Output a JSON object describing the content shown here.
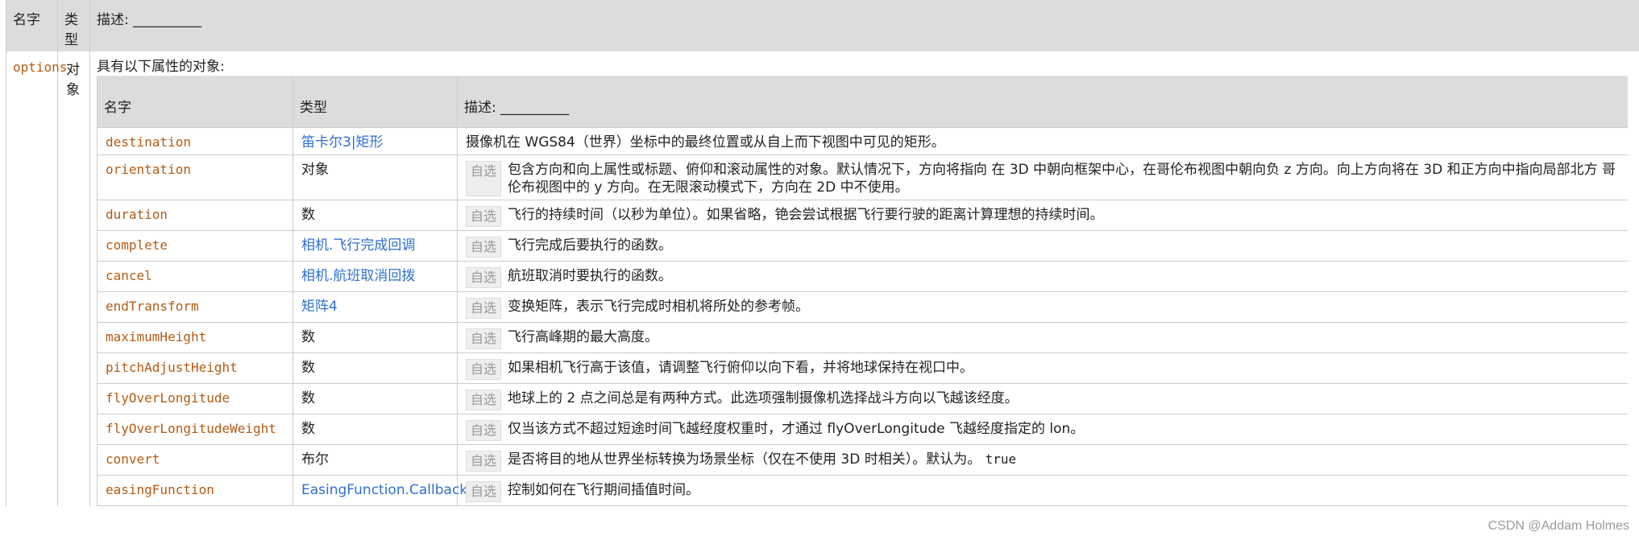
{
  "header": {
    "name": "名字",
    "type": "类型",
    "desc": "描述: __________"
  },
  "param": {
    "name": "options",
    "type": "对象",
    "intro": "具有以下属性的对象:"
  },
  "sub_header": {
    "name": "名字",
    "type": "类型",
    "desc": "描述: __________"
  },
  "optional_label": "自选",
  "rows": [
    {
      "name": "destination",
      "type": "笛卡尔3|矩形",
      "type_link": true,
      "optional": false,
      "desc": "摄像机在 WGS84（世界）坐标中的最终位置或从自上而下视图中可见的矩形。"
    },
    {
      "name": "orientation",
      "type": "对象",
      "type_link": false,
      "optional": true,
      "desc": "包含方向和向上属性或标题、俯仰和滚动属性的对象。默认情况下，方向将指向 在 3D 中朝向框架中心，在哥伦布视图中朝向负 z 方向。向上方向将在 3D 和正方向中指向局部北方 哥伦布视图中的 y 方向。在无限滚动模式下，方向在 2D 中不使用。"
    },
    {
      "name": "duration",
      "type": "数",
      "type_link": false,
      "optional": true,
      "desc": "飞行的持续时间（以秒为单位）。如果省略，铯会尝试根据飞行要行驶的距离计算理想的持续时间。"
    },
    {
      "name": "complete",
      "type": "相机.飞行完成回调",
      "type_link": true,
      "optional": true,
      "desc": "飞行完成后要执行的函数。"
    },
    {
      "name": "cancel",
      "type": "相机.航班取消回拨",
      "type_link": true,
      "optional": true,
      "desc": "航班取消时要执行的函数。"
    },
    {
      "name": "endTransform",
      "type": "矩阵4",
      "type_link": true,
      "optional": true,
      "desc": "变换矩阵，表示飞行完成时相机将所处的参考帧。"
    },
    {
      "name": "maximumHeight",
      "type": "数",
      "type_link": false,
      "optional": true,
      "desc": "飞行高峰期的最大高度。"
    },
    {
      "name": "pitchAdjustHeight",
      "type": "数",
      "type_link": false,
      "optional": true,
      "desc": "如果相机飞行高于该值，请调整飞行俯仰以向下看，并将地球保持在视口中。"
    },
    {
      "name": "flyOverLongitude",
      "type": "数",
      "type_link": false,
      "optional": true,
      "desc": "地球上的 2 点之间总是有两种方式。此选项强制摄像机选择战斗方向以飞越该经度。"
    },
    {
      "name": "flyOverLongitudeWeight",
      "type": "数",
      "type_link": false,
      "optional": true,
      "desc": "仅当该方式不超过短途时间飞越经度权重时，才通过 flyOverLongitude 飞越经度指定的 lon。"
    },
    {
      "name": "convert",
      "type": "布尔",
      "type_link": false,
      "optional": true,
      "desc": "是否将目的地从世界坐标转换为场景坐标（仅在不使用 3D 时相关）。默认为。",
      "code": "true"
    },
    {
      "name": "easingFunction",
      "type": "EasingFunction.Callback",
      "type_link": true,
      "optional": true,
      "desc": "控制如何在飞行期间插值时间。"
    }
  ],
  "watermark": "CSDN @Addam Holmes"
}
